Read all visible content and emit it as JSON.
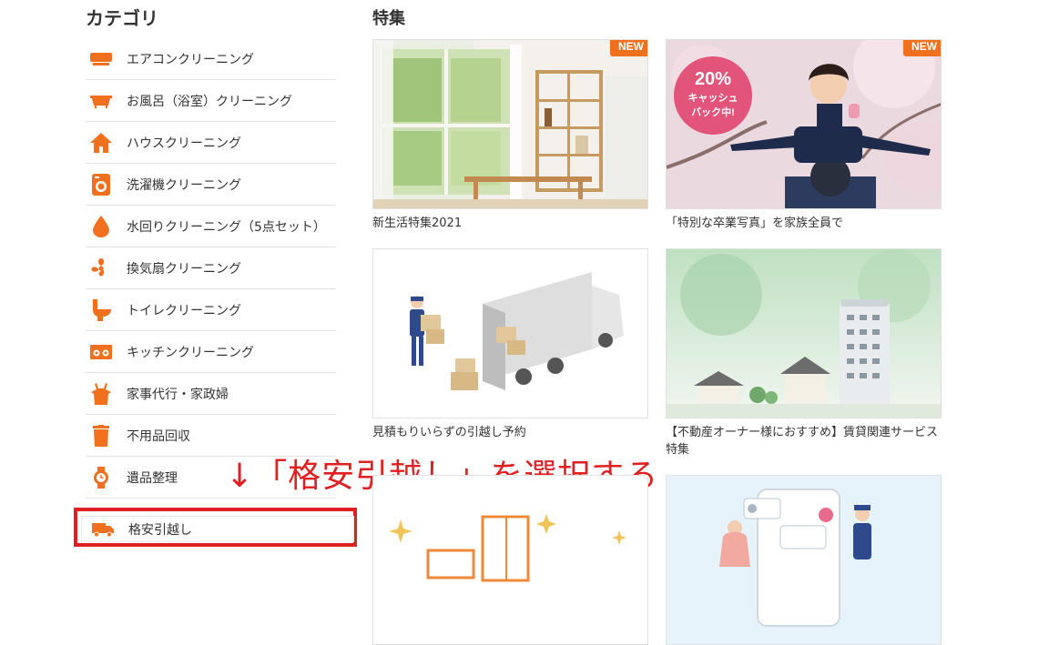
{
  "sidebar": {
    "title": "カテゴリ",
    "items": [
      {
        "label": "エアコンクリーニング",
        "icon": "air-conditioner-icon"
      },
      {
        "label": "お風呂（浴室）クリーニング",
        "icon": "bathtub-icon"
      },
      {
        "label": "ハウスクリーニング",
        "icon": "house-icon"
      },
      {
        "label": "洗濯機クリーニング",
        "icon": "washing-machine-icon"
      },
      {
        "label": "水回りクリーニング（5点セット）",
        "icon": "water-drop-icon"
      },
      {
        "label": "換気扇クリーニング",
        "icon": "fan-icon"
      },
      {
        "label": "トイレクリーニング",
        "icon": "toilet-icon"
      },
      {
        "label": "キッチンクリーニング",
        "icon": "kitchen-stove-icon"
      },
      {
        "label": "家事代行・家政婦",
        "icon": "apron-icon"
      },
      {
        "label": "不用品回収",
        "icon": "trash-can-icon"
      },
      {
        "label": "遺品整理",
        "icon": "watch-icon"
      }
    ],
    "highlighted_item": {
      "label": "格安引越し",
      "icon": "truck-icon"
    }
  },
  "featured": {
    "title": "特集",
    "badge_label": "NEW",
    "cards": [
      {
        "caption": "新生活特集2021",
        "badge": "NEW"
      },
      {
        "caption": "「特別な卒業写真」を家族全員で",
        "badge": "NEW",
        "sticker_line1": "20%",
        "sticker_line2": "キャッシュ",
        "sticker_line3": "バック中!"
      },
      {
        "caption": "見積もりいらずの引越し予約"
      },
      {
        "caption": "【不動産オーナー様におすすめ】賃貸関連サービス特集"
      }
    ]
  },
  "annotation": {
    "text": "↓「格安引越し」を選択する"
  },
  "colors": {
    "accent": "#f0701e",
    "highlight": "#e02020"
  }
}
